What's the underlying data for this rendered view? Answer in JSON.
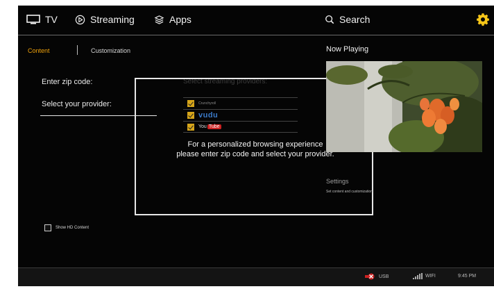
{
  "nav": {
    "tv_label": "TV",
    "streaming_label": "Streaming",
    "apps_label": "Apps",
    "search_label": "Search",
    "settings_icon": "gear-icon",
    "accent_color": "#f5c518"
  },
  "tabs": {
    "content": "Content",
    "customization": "Customization",
    "active_color": "#f1a30c"
  },
  "form": {
    "zip_label": "Enter zip code:",
    "provider_label": "Select your provider:",
    "show_hd_label": "Show HD Content",
    "show_hd_checked": false
  },
  "providers": {
    "title": "Select streaming providers:",
    "items": [
      {
        "name": "Crunchyroll",
        "checked": true
      },
      {
        "name": "vudu",
        "checked": true
      },
      {
        "name": "YouTube",
        "name_a": "You",
        "name_b": "Tube",
        "checked": true
      }
    ]
  },
  "overlay": {
    "line1": "For a personalized browsing experience",
    "line2": "please enter zip code and select your provider."
  },
  "right": {
    "now_playing": "Now Playing",
    "settings_title": "Settings",
    "settings_subtitle": "Set content and customization"
  },
  "status": {
    "usb_label": "USB",
    "wifi_label": "WIFI",
    "time": "9:45 PM"
  }
}
